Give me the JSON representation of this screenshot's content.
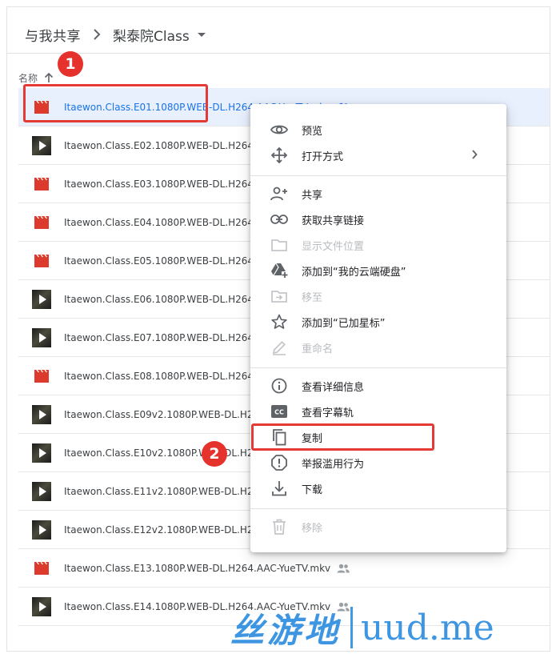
{
  "breadcrumb": {
    "root": "与我共享",
    "current": "梨泰院Class"
  },
  "list_header": {
    "name_label": "名称"
  },
  "annotations": {
    "badge_1": "1",
    "badge_2": "2"
  },
  "files": [
    {
      "name": "Itaewon.Class.E01.1080P.WEB-DL.H264.AAC-YueTV.mkv",
      "icon": "red-video-icon",
      "selected": true
    },
    {
      "name": "Itaewon.Class.E02.1080P.WEB-DL.H264.",
      "icon": "video-thumbnail"
    },
    {
      "name": "Itaewon.Class.E03.1080P.WEB-DL.H264.",
      "icon": "red-video-icon"
    },
    {
      "name": "Itaewon.Class.E04.1080P.WEB-DL.H264.",
      "icon": "red-video-icon"
    },
    {
      "name": "Itaewon.Class.E05.1080P.WEB-DL.H264.",
      "icon": "red-video-icon"
    },
    {
      "name": "Itaewon.Class.E06.1080P.WEB-DL.H264.",
      "icon": "video-thumbnail"
    },
    {
      "name": "Itaewon.Class.E07.1080P.WEB-DL.H264.",
      "icon": "video-thumbnail"
    },
    {
      "name": "Itaewon.Class.E08.1080P.WEB-DL.H264.",
      "icon": "red-video-icon"
    },
    {
      "name": "Itaewon.Class.E09v2.1080P.WEB-DL.H26",
      "icon": "video-thumbnail"
    },
    {
      "name": "Itaewon.Class.E10v2.1080P.WEB-DL.H26",
      "icon": "video-thumbnail"
    },
    {
      "name": "Itaewon.Class.E11v2.1080P.WEB-DL.H26",
      "icon": "video-thumbnail"
    },
    {
      "name": "Itaewon.Class.E12v2.1080P.WEB-DL.H26",
      "icon": "video-thumbnail"
    },
    {
      "name": "Itaewon.Class.E13.1080P.WEB-DL.H264.AAC-YueTV.mkv",
      "icon": "red-video-icon",
      "shared": true
    },
    {
      "name": "Itaewon.Class.E14.1080P.WEB-DL.H264.AAC-YueTV.mkv",
      "icon": "video-thumbnail",
      "shared": true
    }
  ],
  "context_menu": {
    "preview": "预览",
    "open_with": "打开方式",
    "share": "共享",
    "get_link": "获取共享链接",
    "show_location": "显示文件位置",
    "add_to_drive": "添加到“我的云端硬盘”",
    "move_to": "移至",
    "add_star": "添加到“已加星标”",
    "rename": "重命名",
    "details": "查看详细信息",
    "subtitles": "查看字幕轨",
    "copy": "复制",
    "report_abuse": "举报滥用行为",
    "download": "下载",
    "remove": "移除"
  },
  "watermark": {
    "cn": "丝游地",
    "en": "uud.me"
  },
  "colors": {
    "accent_blue": "#1a73e8",
    "selected_row": "#e8f0fe",
    "annotation_red": "#e53935",
    "video_red": "#db3a2c",
    "watermark_blue": "#2e8ee0"
  }
}
